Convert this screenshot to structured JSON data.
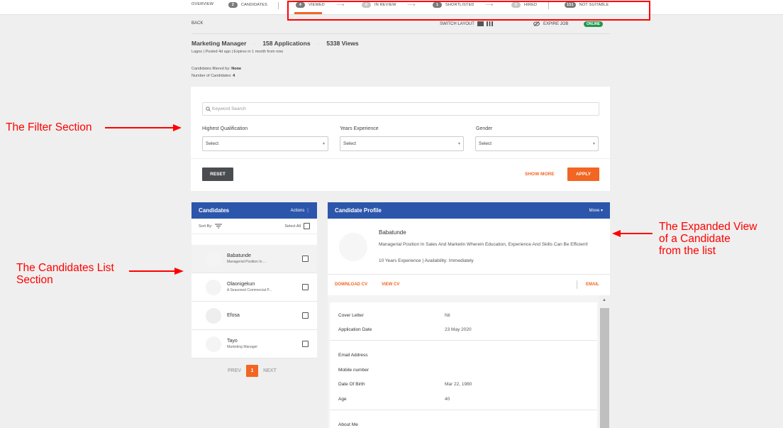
{
  "topnav": {
    "overview": "OVERVIEW",
    "candidates": {
      "count": "2",
      "label": "CANDIDATES"
    },
    "viewed": {
      "count": "4",
      "label": "VIEWED"
    },
    "in_review": {
      "count": "0",
      "label": "IN REVIEW"
    },
    "shortlisted": {
      "count": "1",
      "label": "SHORTLISTED"
    },
    "hired": {
      "count": "0",
      "label": "HIRED"
    },
    "not_suitable": {
      "count": "151",
      "label": "NOT SUITABLE"
    },
    "arrow": "⟶"
  },
  "header": {
    "back": "BACK",
    "switch_layout": "SWITCH LAYOUT",
    "expire_job": "EXPIRE JOB",
    "status": "ONLINE",
    "job_title": "Marketing Manager",
    "applications": "158 Applications",
    "views": "5338 Views",
    "meta": "Lagos | Posted 4d ago | Expires in 1 month from now",
    "filtered_by_label": "Candidates filtered by:",
    "filtered_by_value": "None",
    "num_candidates_label": "Number of Candidates:",
    "num_candidates_value": "4"
  },
  "filter": {
    "keyword_placeholder": "Keyword Search",
    "qualification_label": "Highest Qualification",
    "experience_label": "Years Experience",
    "gender_label": "Gender",
    "select": "Select",
    "reset": "RESET",
    "show_more": "SHOW MORE",
    "apply": "APPLY"
  },
  "candidates": {
    "title": "Candidates",
    "actions": "Actions ⋮",
    "sort_by": "Sort By:",
    "select_all": "Select All",
    "list": [
      {
        "name": "Babatunde",
        "sub": "Managerial Position In ..."
      },
      {
        "name": "Olaonigekun",
        "sub": "A Seasoned Commercial P..."
      },
      {
        "name": "Efosa",
        "sub": ""
      },
      {
        "name": "Tayo",
        "sub": "Marketing Manager"
      }
    ],
    "prev": "PREV",
    "page": "1",
    "next": "NEXT"
  },
  "profile": {
    "title": "Candidate Profile",
    "move": "Move ▾",
    "name": "Babatunde",
    "description": "Managerial Position In Sales And Marketin Wherein Education, Experience And Skills Can Be Efficient!",
    "experience": "10 Years Experience | Availability: Immediately",
    "download_cv": "DOWNLOAD CV",
    "view_cv": "VIEW CV",
    "email": "EMAIL",
    "details": {
      "cover_letter_label": "Cover Letter",
      "cover_letter_value": "Nil",
      "application_date_label": "Application Date",
      "application_date_value": "23 May 2020",
      "email_label": "Email Address",
      "mobile_label": "Mobile number",
      "dob_label": "Date Of Birth",
      "dob_value": "Mar 22, 1980",
      "age_label": "Age",
      "age_value": "40",
      "about_label": "About Me"
    }
  },
  "annotations": {
    "filter": "The Filter Section",
    "list_line1": "The Candidates List",
    "list_line2": "Section",
    "expanded_line1": "The Expanded View",
    "expanded_line2": "of a Candidate",
    "expanded_line3": "from the list"
  },
  "colors": {
    "accent": "#f26522",
    "panel_header": "#2b56ab",
    "online": "#1f9a4e",
    "annotation": "#ff0000"
  }
}
